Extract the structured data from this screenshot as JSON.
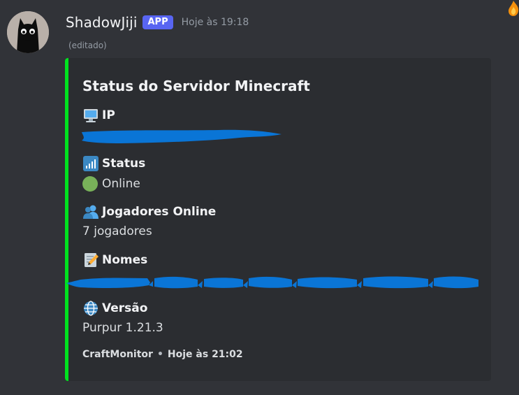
{
  "message": {
    "author": "ShadowJiji",
    "badge": "APP",
    "timestamp": "Hoje às 19:18",
    "edited_label": "(editado)"
  },
  "embed": {
    "accent_color": "#00e31f",
    "title": "Status do Servidor Minecraft",
    "fields": {
      "ip": {
        "name": "IP",
        "icon": "computer-icon"
      },
      "status": {
        "name": "Status",
        "value": "Online",
        "icon": "signal-bars-icon"
      },
      "players": {
        "name": "Jogadores Online",
        "value": "7 jogadores",
        "icon": "players-icon"
      },
      "names": {
        "name": "Nomes",
        "icon": "memo-icon"
      },
      "version": {
        "name": "Versão",
        "value": "Purpur 1.21.3",
        "icon": "globe-icon"
      }
    },
    "footer": {
      "source": "CraftMonitor",
      "separator": "•",
      "time": "Hoje às 21:02"
    }
  },
  "colors": {
    "background": "#313338",
    "embed_background": "#2b2d31",
    "badge": "#5865f2",
    "redaction": "#0a75d6",
    "online_dot": "#78b159"
  }
}
